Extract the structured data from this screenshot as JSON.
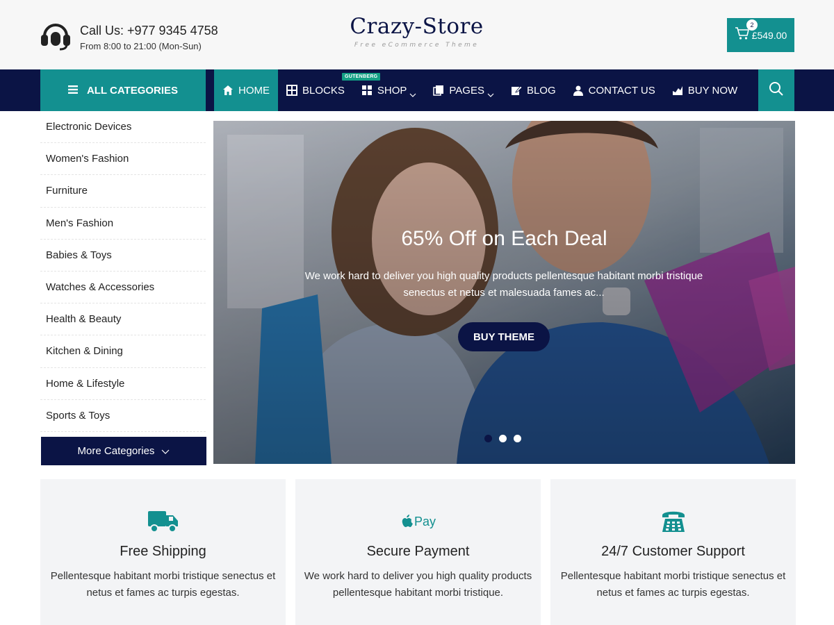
{
  "header": {
    "phone": "Call Us: +977 9345 4758",
    "hours": "From 8:00 to 21:00 (Mon-Sun)",
    "logo_name": "Crazy-Store",
    "logo_tagline": "Free eCommerce Theme",
    "cart_count": "2",
    "cart_total": "£549.00"
  },
  "nav": {
    "all_categories": "ALL CATEGORIES",
    "items": [
      {
        "label": "HOME",
        "icon": "home-icon",
        "active": true
      },
      {
        "label": "BLOCKS",
        "icon": "blocks-icon"
      },
      {
        "label": "SHOP",
        "icon": "grid-icon",
        "dropdown": true,
        "badge": "GUTENBERG"
      },
      {
        "label": "PAGES",
        "icon": "pages-icon",
        "dropdown": true
      },
      {
        "label": "BLOG",
        "icon": "edit-icon"
      },
      {
        "label": "CONTACT US",
        "icon": "user-icon"
      },
      {
        "label": "BUY NOW",
        "icon": "chart-icon"
      }
    ]
  },
  "sidebar": {
    "categories": [
      "Electronic Devices",
      "Women's Fashion",
      "Furniture",
      "Men's Fashion",
      "Babies & Toys",
      "Watches & Accessories",
      "Health & Beauty",
      "Kitchen & Dining",
      "Home & Lifestyle",
      "Sports & Toys"
    ],
    "more": "More Categories"
  },
  "slider": {
    "title": "65% Off on Each Deal",
    "description": "We work hard to deliver you high quality products pellentesque habitant morbi tristique senectus et netus et malesuada fames ac...",
    "button": "BUY THEME"
  },
  "features": [
    {
      "icon": "truck-icon",
      "title": "Free Shipping",
      "text": "Pellentesque habitant morbi tristique senectus et netus et fames ac turpis egestas."
    },
    {
      "icon": "apple-pay-icon",
      "title": "Secure Payment",
      "text": "We work hard to deliver you high quality products pellentesque habitant morbi tristique."
    },
    {
      "icon": "phone-icon",
      "title": "24/7 Customer Support",
      "text": "Pellentesque habitant morbi tristique senectus et netus et fames ac turpis egestas."
    }
  ],
  "colors": {
    "navy": "#0b1445",
    "teal": "#139090",
    "badge": "#14a085"
  }
}
